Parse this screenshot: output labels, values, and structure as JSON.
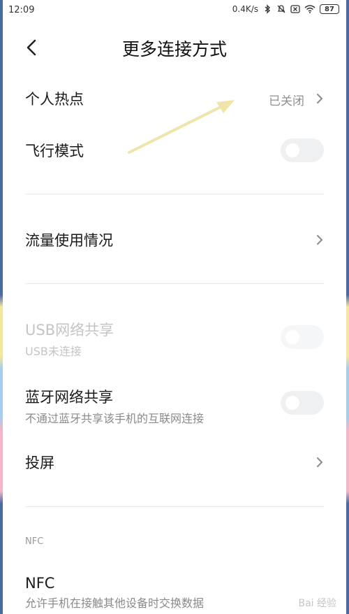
{
  "status_bar": {
    "time": "12:09",
    "speed": "0.4K/s",
    "battery": "87"
  },
  "header": {
    "title": "更多连接方式"
  },
  "items": [
    {
      "label": "个人热点",
      "value": "已关闭"
    },
    {
      "label": "飞行模式"
    },
    {
      "label": "流量使用情况"
    },
    {
      "label": "USB网络共享",
      "sub": "USB未连接"
    },
    {
      "label": "蓝牙网络共享",
      "sub": "不通过蓝牙共享该手机的互联网连接"
    },
    {
      "label": "投屏"
    }
  ],
  "nfc_section": {
    "header": "NFC",
    "label": "NFC",
    "sub": "允许手机在接触其他设备时交换数据"
  },
  "watermark": "Bai 经验",
  "colors": {
    "accent_arrow": "#f0e4a8",
    "toggle_off": "#eef0f2"
  }
}
